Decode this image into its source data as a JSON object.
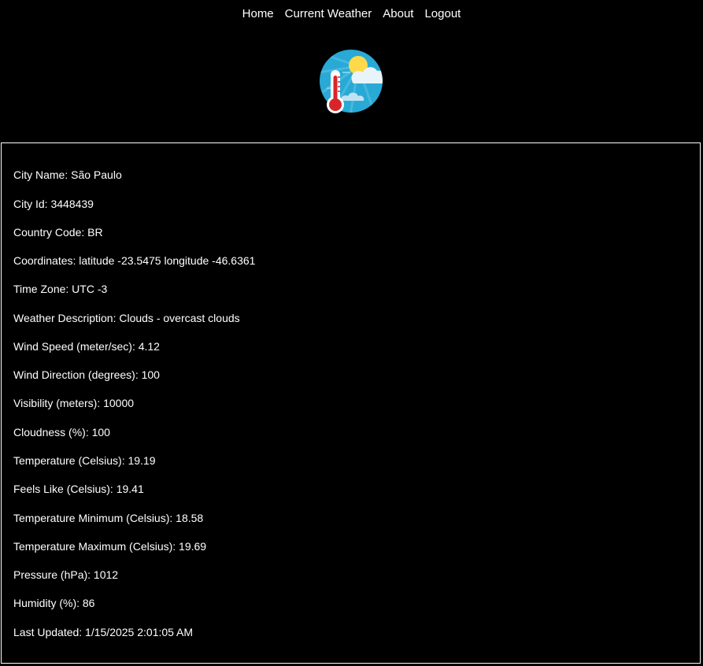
{
  "nav": {
    "items": [
      "Home",
      "Current Weather",
      "About",
      "Logout"
    ]
  },
  "logo": {
    "icon": "weather-thermometer-logo"
  },
  "details": {
    "rows": [
      "City Name: São Paulo",
      "City Id: 3448439",
      "Country Code: BR",
      "Coordinates: latitude -23.5475 longitude -46.6361",
      "Time Zone: UTC -3",
      "Weather Description: Clouds - overcast clouds",
      "Wind Speed (meter/sec): 4.12",
      "Wind Direction (degrees): 100",
      "Visibility (meters): 10000",
      "Cloudness (%): 100",
      "Temperature (Celsius): 19.19",
      "Feels Like (Celsius): 19.41",
      "Temperature Minimum (Celsius): 18.58",
      "Temperature Maximum (Celsius): 19.69",
      "Pressure (hPa): 1012",
      "Humidity (%): 86",
      "Last Updated: 1/15/2025 2:01:05 AM"
    ]
  },
  "colors": {
    "background": "#000000",
    "text": "#ffffff",
    "logo_sky": "#29a9d6",
    "logo_sun": "#ffd94a",
    "logo_cloud": "#e8f4fa",
    "logo_mercury": "#d6262c"
  }
}
